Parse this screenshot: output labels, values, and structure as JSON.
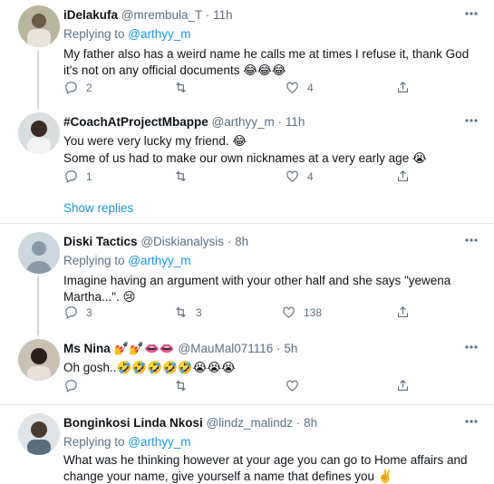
{
  "tweets": [
    {
      "name": "iDelakufa",
      "handle": "@mrembula_T",
      "sep": "·",
      "time": "11h",
      "replying_prefix": "Replying to ",
      "replying_handle": "@arthyy_m",
      "line1": "My father also has a weird name he calls me at times I refuse it, thank God",
      "line2": "it's not on any official documents 😂😂😂",
      "replies": "2",
      "retweets": "",
      "likes": "4"
    },
    {
      "name": "#CoachAtProjectMbappe",
      "handle": "@arthyy_m",
      "sep": "·",
      "time": "11h",
      "line1": "You were very lucky my friend. 😂",
      "line2": "Some of us had to make our own nicknames at a very early age 😭",
      "replies": "1",
      "retweets": "",
      "likes": "4"
    },
    {
      "name": "Diski Tactics",
      "handle": "@Diskianalysis",
      "sep": "·",
      "time": "8h",
      "replying_prefix": "Replying to ",
      "replying_handle": "@arthyy_m",
      "line1": "Imagine having an argument with your other half and she says \"yewena",
      "line2": "Martha...\". 😢",
      "replies": "3",
      "retweets": "3",
      "likes": "138"
    },
    {
      "name": "Ms Nina 💅💅👄👄",
      "handle": "@MauMal071116",
      "sep": "·",
      "time": "5h",
      "line1": "Oh gosh..🤣🤣🤣🤣🤣😭😭😭",
      "replies": "",
      "retweets": "",
      "likes": ""
    },
    {
      "name": "Bonginkosi Linda Nkosi",
      "handle": "@lindz_malindz",
      "sep": "·",
      "time": "8h",
      "replying_prefix": "Replying to ",
      "replying_handle": "@arthyy_m",
      "line1": "What was he thinking however at your age you can go to Home affairs and",
      "line2": "change your name, give yourself a name that defines you ✌️"
    }
  ],
  "show_replies": "Show replies",
  "icons": {
    "reply": "reply-icon",
    "retweet": "retweet-icon",
    "like": "heart-icon",
    "share": "share-icon",
    "more": "more-icon"
  }
}
